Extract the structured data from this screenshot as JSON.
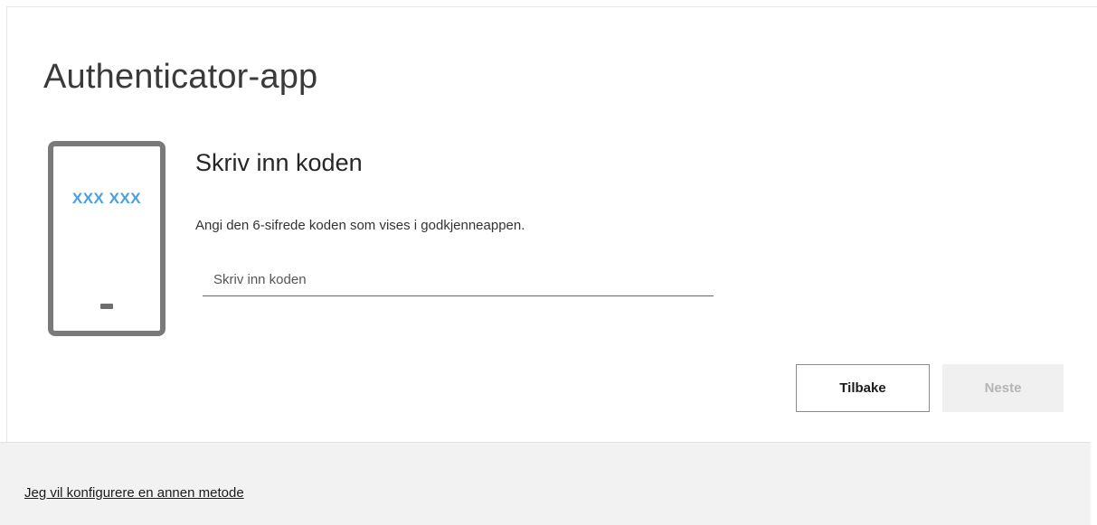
{
  "page": {
    "title": "Authenticator-app"
  },
  "illustration": {
    "phone_code": "XXX XXX"
  },
  "step": {
    "heading": "Skriv inn koden",
    "description": "Angi den 6-sifrede koden som vises i godkjenneappen.",
    "code_input": {
      "placeholder": "Skriv inn koden",
      "value": ""
    }
  },
  "buttons": {
    "back_label": "Tilbake",
    "next_label": "Neste",
    "next_disabled": true
  },
  "footer": {
    "alt_method_link": "Jeg vil konfigurere en annen metode"
  },
  "colors": {
    "accent_code": "#4aa0e0",
    "phone_frame": "#7a7a7a",
    "footer_bg": "#f2f2f2",
    "disabled_button_bg": "#f0f0f0"
  }
}
